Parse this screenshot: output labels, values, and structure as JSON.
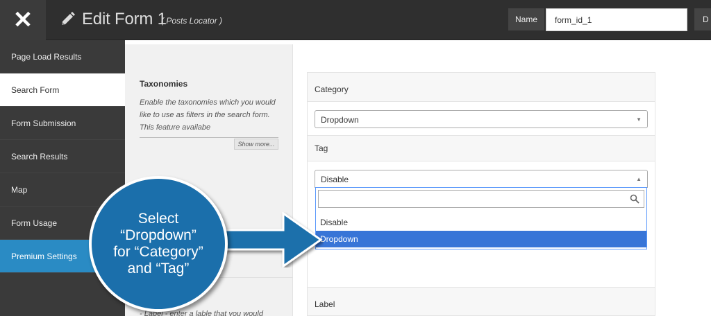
{
  "topbar": {
    "title": "Edit Form 1",
    "subtitle": "( Posts Locator )",
    "name_label": "Name",
    "name_value": "form_id_1",
    "extra_label": "D"
  },
  "sidebar": {
    "items": [
      {
        "label": "Page Load Results"
      },
      {
        "label": "Search Form"
      },
      {
        "label": "Form Submission"
      },
      {
        "label": "Search Results"
      },
      {
        "label": "Map"
      },
      {
        "label": "Form Usage"
      },
      {
        "label": "Premium Settings"
      }
    ]
  },
  "taxonomies": {
    "title": "Taxonomies",
    "description": "Enable the taxonomies which you would like to use as filters in the search form. This feature availabe",
    "show_more": "Show more...",
    "bottom_desc": "- Label - enter a lable that you would"
  },
  "category": {
    "label": "Category",
    "selected": "Dropdown"
  },
  "tag": {
    "label": "Tag",
    "selected": "Disable"
  },
  "dropdown": {
    "options": [
      "Disable",
      "Dropdown"
    ]
  },
  "label_panel": {
    "label": "Label"
  },
  "callout": {
    "line1": "Select",
    "line2": "“Dropdown”",
    "line3": "for “Category”",
    "line4": "and “Tag”"
  },
  "colors": {
    "sidebar_bg": "#3a3a3a",
    "premium_accent": "#2a8bc4",
    "callout_blue": "#1b6fab",
    "highlight": "#3875d7"
  }
}
